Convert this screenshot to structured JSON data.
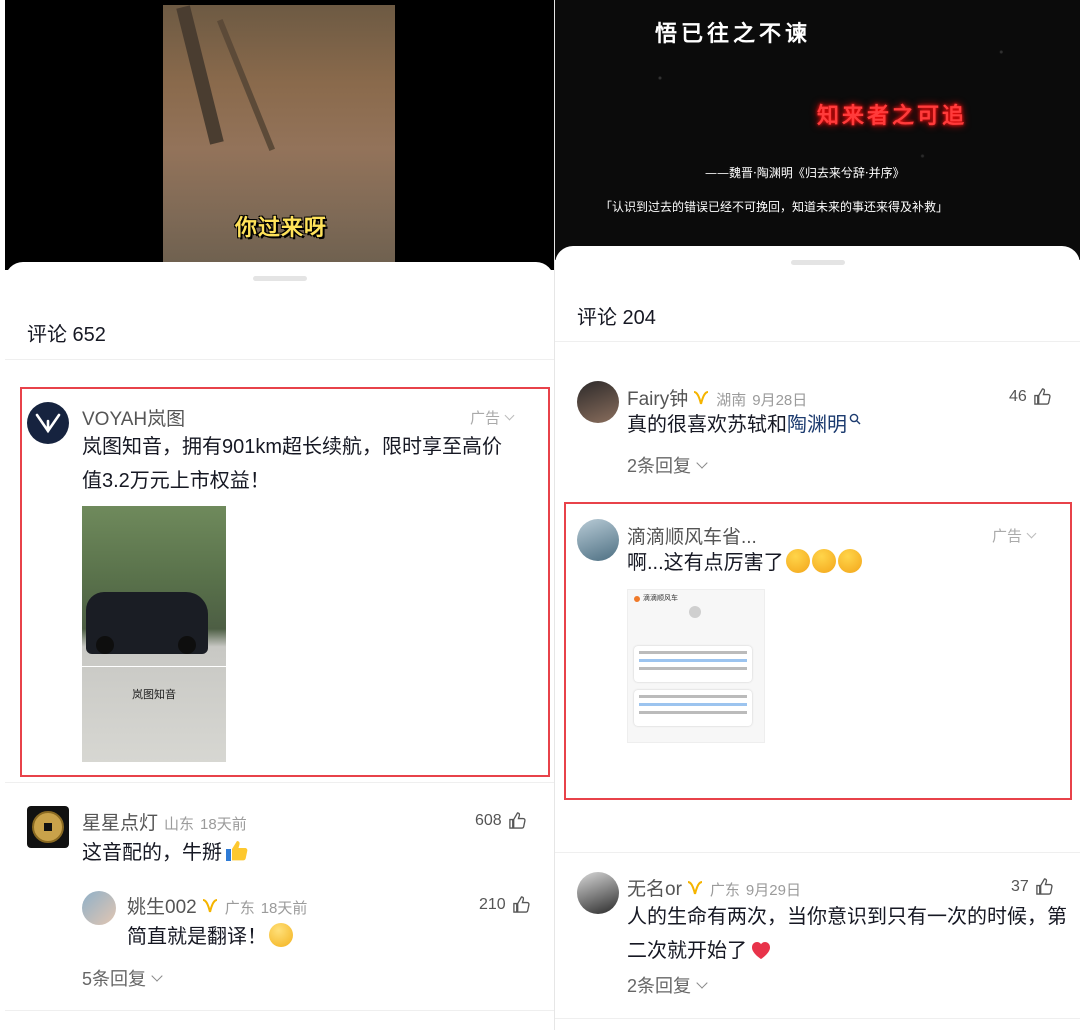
{
  "left": {
    "video_subtitle": "你过来呀",
    "comments_title": "评论 652",
    "ad_comment": {
      "user": "VOYAH岚图",
      "ad_label": "广告",
      "text_line1": "岚图知音，拥有901km超长续航，限时享至高价",
      "text_line2": "值3.2万元上市权益！",
      "image_caption": "岚图知音"
    },
    "comment1": {
      "user": "星星点灯",
      "location": "山东",
      "time": "18天前",
      "likes": "608",
      "text": "这音配的，牛掰"
    },
    "reply1": {
      "user": "姚生002",
      "location": "广东",
      "time": "18天前",
      "likes": "210",
      "text": "简直就是翻译！"
    },
    "more_replies": "5条回复"
  },
  "right": {
    "poem_line1": "悟已往之不谏",
    "poem_line2": "知来者之可追",
    "poem_source": "——魏晋·陶渊明《归去来兮辞·并序》",
    "poem_translation": "「认识到过去的错误已经不可挽回，知道未来的事还来得及补救」",
    "comments_title": "评论 204",
    "comment1": {
      "user": "Fairy钟",
      "location": "湖南",
      "time": "9月28日",
      "likes": "46",
      "text_prefix": "真的很喜欢苏轼和",
      "text_link": "陶渊明",
      "replies": "2条回复"
    },
    "ad_comment": {
      "user": "滴滴顺风车省...",
      "ad_label": "广告",
      "text": "啊...这有点厉害了",
      "image_title": "滴滴顺风车"
    },
    "comment2": {
      "user": "无名or",
      "location": "广东",
      "time": "9月29日",
      "likes": "37",
      "text_line1": "人的生命有两次，当你意识到只有一次的时候，第",
      "text_line2": "二次就开始了",
      "replies": "2条回复"
    }
  },
  "colors": {
    "highlight_box": "#e8424a",
    "link": "#1c3b6f",
    "badge": "#f5b400"
  }
}
